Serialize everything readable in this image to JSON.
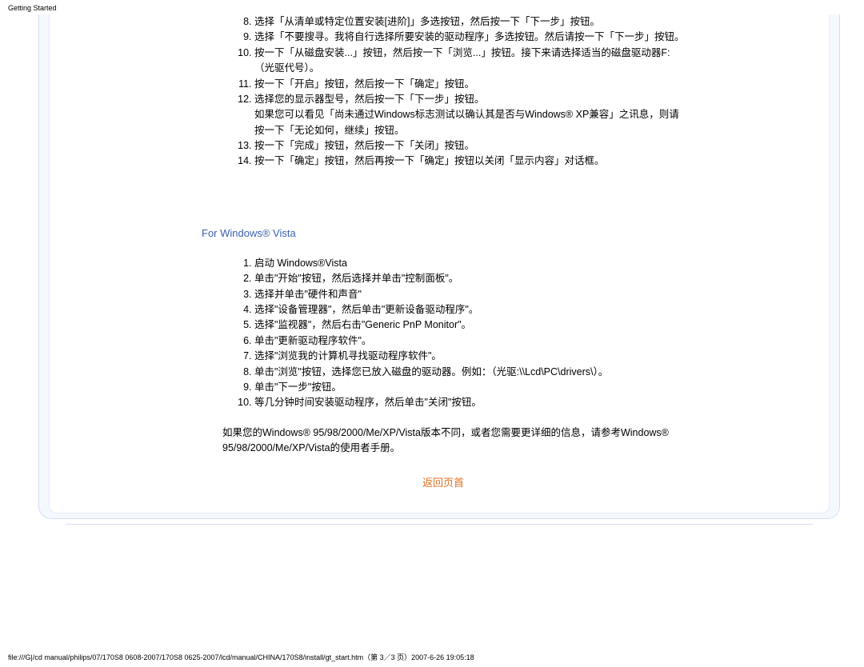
{
  "header": {
    "label": "Getting Started"
  },
  "list1": {
    "start": 8,
    "items": [
      "选择「从清单或特定位置安装[进阶]」多选按钮，然后按一下「下一步」按钮。",
      "选择「不要搜寻。我将自行选择所要安装的驱动程序」多选按钮。然后请按一下「下一步」按钮。",
      "按一下「从磁盘安装...」按钮，然后按一下「浏览...」按钮。接下来请选择适当的磁盘驱动器F:（光驱代号）。",
      "按一下「开启」按钮，然后按一下「确定」按钮。",
      "选择您的显示器型号，然后按一下「下一步」按钮。\n如果您可以看见「尚未通过Windows标志测试以确认其是否与Windows® XP兼容」之讯息，则请按一下「无论如何，继续」按钮。",
      "按一下「完成」按钮，然后按一下「关闭」按钮。",
      "按一下「确定」按钮，然后再按一下「确定」按钮以关闭「显示内容」对话框。"
    ]
  },
  "section2": {
    "title": "For Windows® Vista"
  },
  "list2": {
    "items": [
      "启动 Windows®Vista",
      "单击\"开始\"按钮，然后选择并单击\"控制面板\"。",
      "选择并单击\"硬件和声音\"",
      "选择\"设备管理器\"，然后单击\"更新设备驱动程序\"。",
      "选择\"监视器\"，然后右击\"Generic PnP Monitor\"。",
      "单击\"更新驱动程序软件\"。",
      "选择\"浏览我的计算机寻找驱动程序软件\"。",
      "单击\"浏览\"按钮，选择您已放入磁盘的驱动器。例如：（光驱:\\\\Lcd\\PC\\drivers\\）。",
      "单击\"下一步\"按钮。",
      "等几分钟时间安装驱动程序，然后单击\"关闭\"按钮。"
    ]
  },
  "paragraph": "如果您的Windows® 95/98/2000/Me/XP/Vista版本不同，或者您需要更详细的信息，请参考Windows® 95/98/2000/Me/XP/Vista的使用者手册。",
  "backLink": {
    "text": "返回页首"
  },
  "footer": {
    "text": "file:///G|/cd manual/philips/07/170S8 0608-2007/170S8 0625-2007/lcd/manual/CHINA/170S8/install/gt_start.htm（第 3／3 页）2007-6-26 19:05:18"
  }
}
